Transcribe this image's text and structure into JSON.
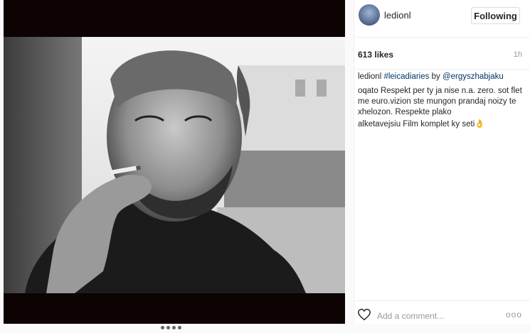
{
  "post": {
    "username": "ledionl",
    "follow_label": "Following",
    "likes": "613 likes",
    "time": "1h"
  },
  "comments": [
    {
      "user": "ledionl",
      "hashtag": "#leicadiaries",
      "by": " by ",
      "mention": "@ergyszhabjaku"
    },
    {
      "user": "oqato",
      "text": " Respekt per ty ja nise n.a. zero. sot flet me euro.vizion ste mungon prandaj noizy te xhelozon. Respekte plako"
    },
    {
      "user": "alketavejsiu",
      "text": " Film komplet ky seti👌"
    }
  ],
  "footer": {
    "add_comment_placeholder": "Add a comment...",
    "more": "ooo"
  },
  "icons": {
    "heart": "heart-icon",
    "options": "more-options-icon"
  }
}
